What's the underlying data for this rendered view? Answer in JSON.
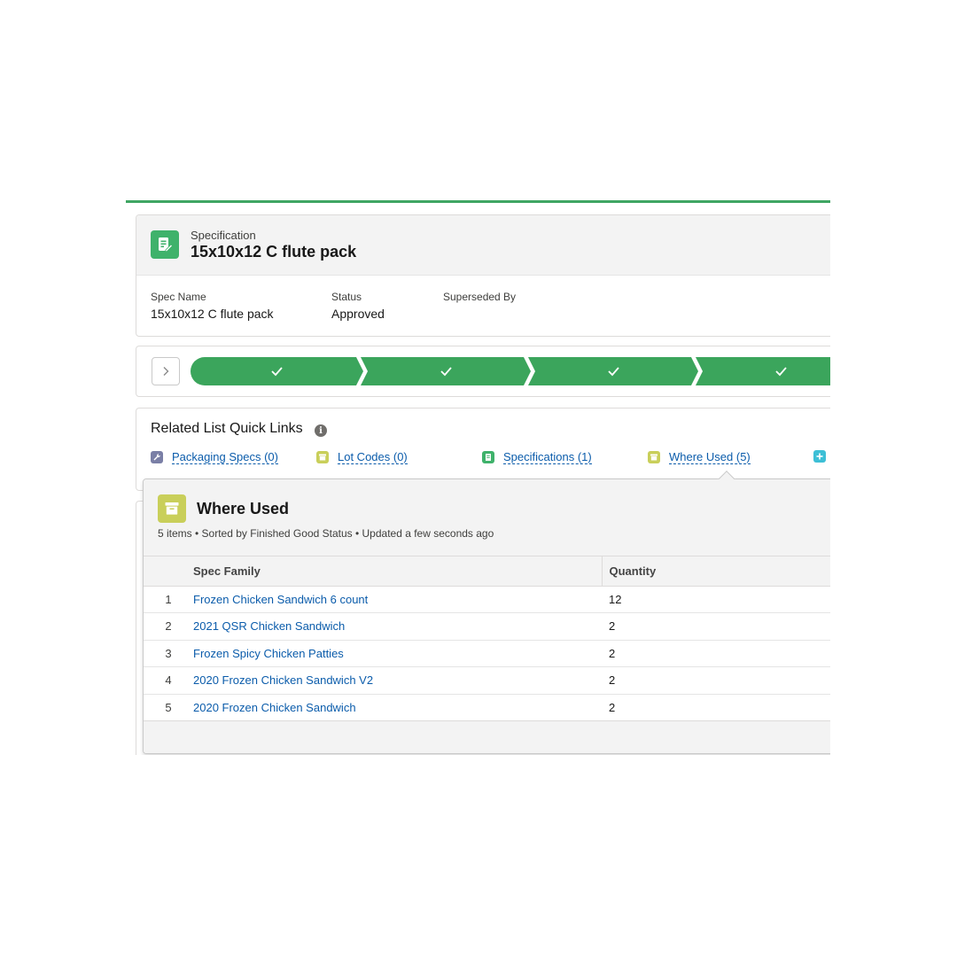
{
  "record": {
    "object_type": "Specification",
    "title": "15x10x12 C flute pack",
    "icon": "specification-icon",
    "fields": [
      {
        "label": "Spec Name",
        "value": "15x10x12 C flute pack"
      },
      {
        "label": "Status",
        "value": "Approved"
      },
      {
        "label": "Superseded By",
        "value": ""
      }
    ]
  },
  "path": {
    "stages_completed": 4,
    "color": "#3ba55c"
  },
  "quick_links": {
    "title": "Related List Quick Links",
    "items": [
      {
        "label": "Packaging Specs (0)",
        "icon": "wrench-icon",
        "color": "#7a7fa6"
      },
      {
        "label": "Lot Codes (0)",
        "icon": "archive-icon",
        "color": "#c9cf5a"
      },
      {
        "label": "Specifications (1)",
        "icon": "document-icon",
        "color": "#3fb26b"
      },
      {
        "label": "Where Used (5)",
        "icon": "archive-icon",
        "color": "#c9cf5a"
      },
      {
        "label": "",
        "icon": "plus-icon",
        "color": "#3dbfd6"
      }
    ]
  },
  "popover": {
    "title": "Where Used",
    "subtitle": "5 items • Sorted by Finished Good Status • Updated a few seconds ago",
    "columns": [
      "Spec Family",
      "Quantity"
    ],
    "rows": [
      {
        "num": "1",
        "family": "Frozen Chicken Sandwich 6 count",
        "quantity": "12"
      },
      {
        "num": "2",
        "family": "2021 QSR Chicken Sandwich",
        "quantity": "2"
      },
      {
        "num": "3",
        "family": "Frozen Spicy Chicken Patties",
        "quantity": "2"
      },
      {
        "num": "4",
        "family": "2020 Frozen Chicken Sandwich V2",
        "quantity": "2"
      },
      {
        "num": "5",
        "family": "2020 Frozen Chicken Sandwich",
        "quantity": "2"
      }
    ]
  }
}
